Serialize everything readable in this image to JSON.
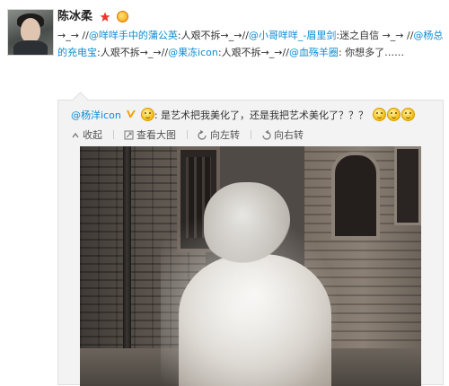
{
  "post": {
    "author": "陈冰柔",
    "segments": [
      {
        "t": "→_→ //",
        "link": false
      },
      {
        "t": "@咩咩手中的蒲公英",
        "link": true
      },
      {
        "t": ":人艰不拆→_→//",
        "link": false
      },
      {
        "t": "@小哥咩咩_-眉里剑",
        "link": true
      },
      {
        "t": ":迷之自信 →_→ //",
        "link": false
      },
      {
        "t": "@杨总的充电宝",
        "link": true
      },
      {
        "t": ":人艰不拆→_→//",
        "link": false
      },
      {
        "t": "@果冻icon",
        "link": true
      },
      {
        "t": ":人艰不拆→_→//",
        "link": false
      },
      {
        "t": "@血殇羊圈",
        "link": true
      },
      {
        "t": ": 你想多了……",
        "link": false
      }
    ]
  },
  "repost": {
    "author": "@杨洋icon",
    "text": ": 是艺术把我美化了，还是我把艺术美化了？？？",
    "toolbar": {
      "collect": "收起",
      "view_large": "查看大图",
      "rotate_left": "向左转",
      "rotate_right": "向右转"
    }
  },
  "icons": {
    "star_color": "#e8392b",
    "link_color": "#0a8cd2",
    "vip_color": "#f0a000"
  }
}
